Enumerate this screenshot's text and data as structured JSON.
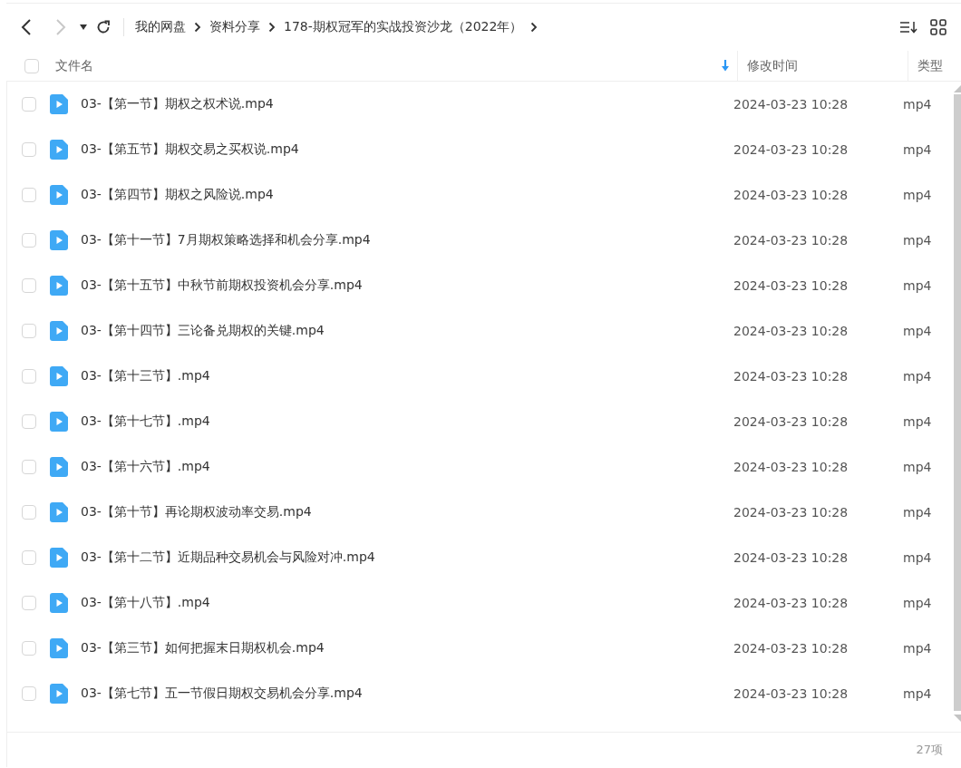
{
  "toolbar": {
    "back_disabled": false,
    "forward_disabled": true
  },
  "breadcrumbs": [
    {
      "label": "我的网盘"
    },
    {
      "label": "资料分享"
    },
    {
      "label": "178-期权冠军的实战投资沙龙（2022年）"
    }
  ],
  "header": {
    "checked": false,
    "columns": [
      {
        "label": "文件名",
        "sorted": true
      },
      {
        "label": "修改时间",
        "sorted": false
      },
      {
        "label": "类型",
        "sorted": false
      }
    ]
  },
  "rows": [
    {
      "name": "03-【第一节】期权之权术说.mp4",
      "modified": "2024-03-23 10:28",
      "type": "mp4",
      "checked": false
    },
    {
      "name": "03-【第五节】期权交易之买权说.mp4",
      "modified": "2024-03-23 10:28",
      "type": "mp4",
      "checked": false
    },
    {
      "name": "03-【第四节】期权之风险说.mp4",
      "modified": "2024-03-23 10:28",
      "type": "mp4",
      "checked": false
    },
    {
      "name": "03-【第十一节】7月期权策略选择和机会分享.mp4",
      "modified": "2024-03-23 10:28",
      "type": "mp4",
      "checked": false
    },
    {
      "name": "03-【第十五节】中秋节前期权投资机会分享.mp4",
      "modified": "2024-03-23 10:28",
      "type": "mp4",
      "checked": false
    },
    {
      "name": "03-【第十四节】三论备兑期权的关键.mp4",
      "modified": "2024-03-23 10:28",
      "type": "mp4",
      "checked": false
    },
    {
      "name": "03-【第十三节】.mp4",
      "modified": "2024-03-23 10:28",
      "type": "mp4",
      "checked": false
    },
    {
      "name": "03-【第十七节】.mp4",
      "modified": "2024-03-23 10:28",
      "type": "mp4",
      "checked": false
    },
    {
      "name": "03-【第十六节】.mp4",
      "modified": "2024-03-23 10:28",
      "type": "mp4",
      "checked": false
    },
    {
      "name": "03-【第十节】再论期权波动率交易.mp4",
      "modified": "2024-03-23 10:28",
      "type": "mp4",
      "checked": false
    },
    {
      "name": "03-【第十二节】近期品种交易机会与风险对冲.mp4",
      "modified": "2024-03-23 10:28",
      "type": "mp4",
      "checked": false
    },
    {
      "name": "03-【第十八节】.mp4",
      "modified": "2024-03-23 10:28",
      "type": "mp4",
      "checked": false
    },
    {
      "name": "03-【第三节】如何把握末日期权机会.mp4",
      "modified": "2024-03-23 10:28",
      "type": "mp4",
      "checked": false
    },
    {
      "name": "03-【第七节】五一节假日期权交易机会分享.mp4",
      "modified": "2024-03-23 10:28",
      "type": "mp4",
      "checked": false
    }
  ],
  "footer": {
    "count": "27项"
  }
}
